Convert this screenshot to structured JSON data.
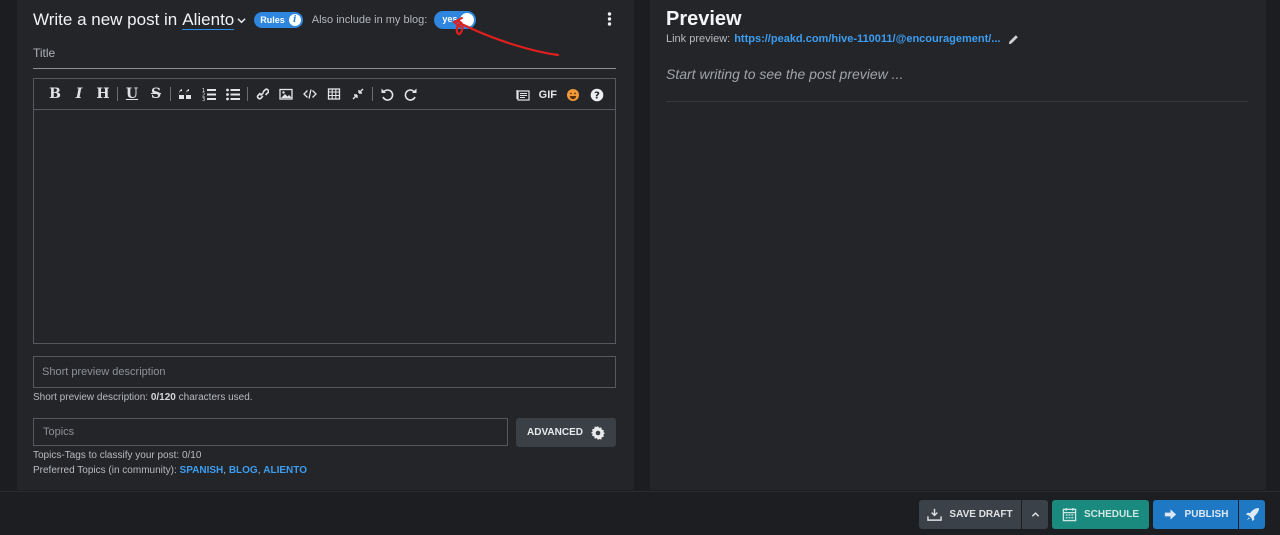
{
  "editor": {
    "header_prefix": "Write a new post in",
    "community": "Aliento",
    "rules_label": "Rules",
    "also_include_label": "Also include in my blog:",
    "toggle_value": "yes",
    "title_placeholder": "Title",
    "toolbar": {
      "left_tools": [
        "bold-icon",
        "italic-icon",
        "heading-icon",
        "underline-icon",
        "strikethrough-icon",
        "quote-icon",
        "ordered-list-icon",
        "bullet-list-icon",
        "link-icon",
        "image-icon",
        "code-icon",
        "table-icon",
        "fullscreen-icon",
        "undo-icon",
        "redo-icon"
      ],
      "gif_label": "GIF",
      "right_tools": [
        "snippets-icon",
        "emoji-icon",
        "help-icon"
      ]
    },
    "short_description_placeholder": "Short preview description",
    "short_description_help_prefix": "Short preview description:",
    "short_description_count": "0/120",
    "short_description_help_suffix": "characters used.",
    "topics_placeholder": "Topics",
    "advanced_label": "ADVANCED",
    "topics_help": "Topics-Tags to classify your post: 0/10",
    "preferred_topics_label": "Preferred Topics (in community):",
    "preferred_topics": [
      "SPANISH",
      "BLOG",
      "ALIENTO"
    ]
  },
  "preview": {
    "title": "Preview",
    "link_label": "Link preview:",
    "link_url": "https://peakd.com/hive-110011/@encouragement/...",
    "placeholder": "Start writing to see the post preview ..."
  },
  "actions": {
    "save_draft": "SAVE DRAFT",
    "schedule": "SCHEDULE",
    "publish": "PUBLISH"
  },
  "colors": {
    "accent": "#2e86de",
    "link": "#3d9df0",
    "schedule": "#1b8a7e",
    "publish": "#1f78c4",
    "annotation": "#e0201e"
  }
}
